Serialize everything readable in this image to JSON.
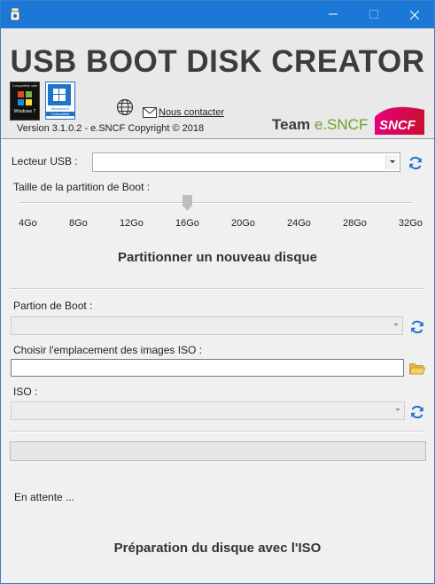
{
  "colors": {
    "titlebar": "#1b78d6",
    "accent_green": "#6aa226",
    "sncf_red": "#c8102e",
    "refresh_blue": "#1f6fd6"
  },
  "window": {
    "min_icon": "minimize-icon",
    "max_icon": "maximize-icon",
    "close_icon": "close-icon"
  },
  "header": {
    "title": "USB BOOT DISK CREATOR",
    "badge7": {
      "line1": "Compatible with",
      "line2": "Windows 7"
    },
    "badge10": {
      "line1": "Windows10",
      "line2": "Compatible"
    },
    "version": "Version 3.1.0.2 - e.SNCF Copyright ©  2018",
    "contact": "Nous contacter",
    "team_prefix": "Team ",
    "team_name": "e.SNCF",
    "sncf_logo_text": "SNCF"
  },
  "usb": {
    "label": "Lecteur USB :",
    "value": ""
  },
  "partition_size": {
    "label": "Taille de la partition de Boot :",
    "ticks": [
      "4Go",
      "8Go",
      "12Go",
      "16Go",
      "20Go",
      "24Go",
      "28Go",
      "32Go"
    ],
    "selected": "16Go"
  },
  "partition_button": "Partitionner un nouveau disque",
  "boot_partition": {
    "label": "Partion de Boot :",
    "value": ""
  },
  "iso_location": {
    "label": "Choisir l'emplacement des images ISO :",
    "value": ""
  },
  "iso": {
    "label": "ISO :",
    "value": ""
  },
  "progress": 0,
  "status": "En attente ...",
  "prepare_button": "Préparation du disque avec l'ISO"
}
